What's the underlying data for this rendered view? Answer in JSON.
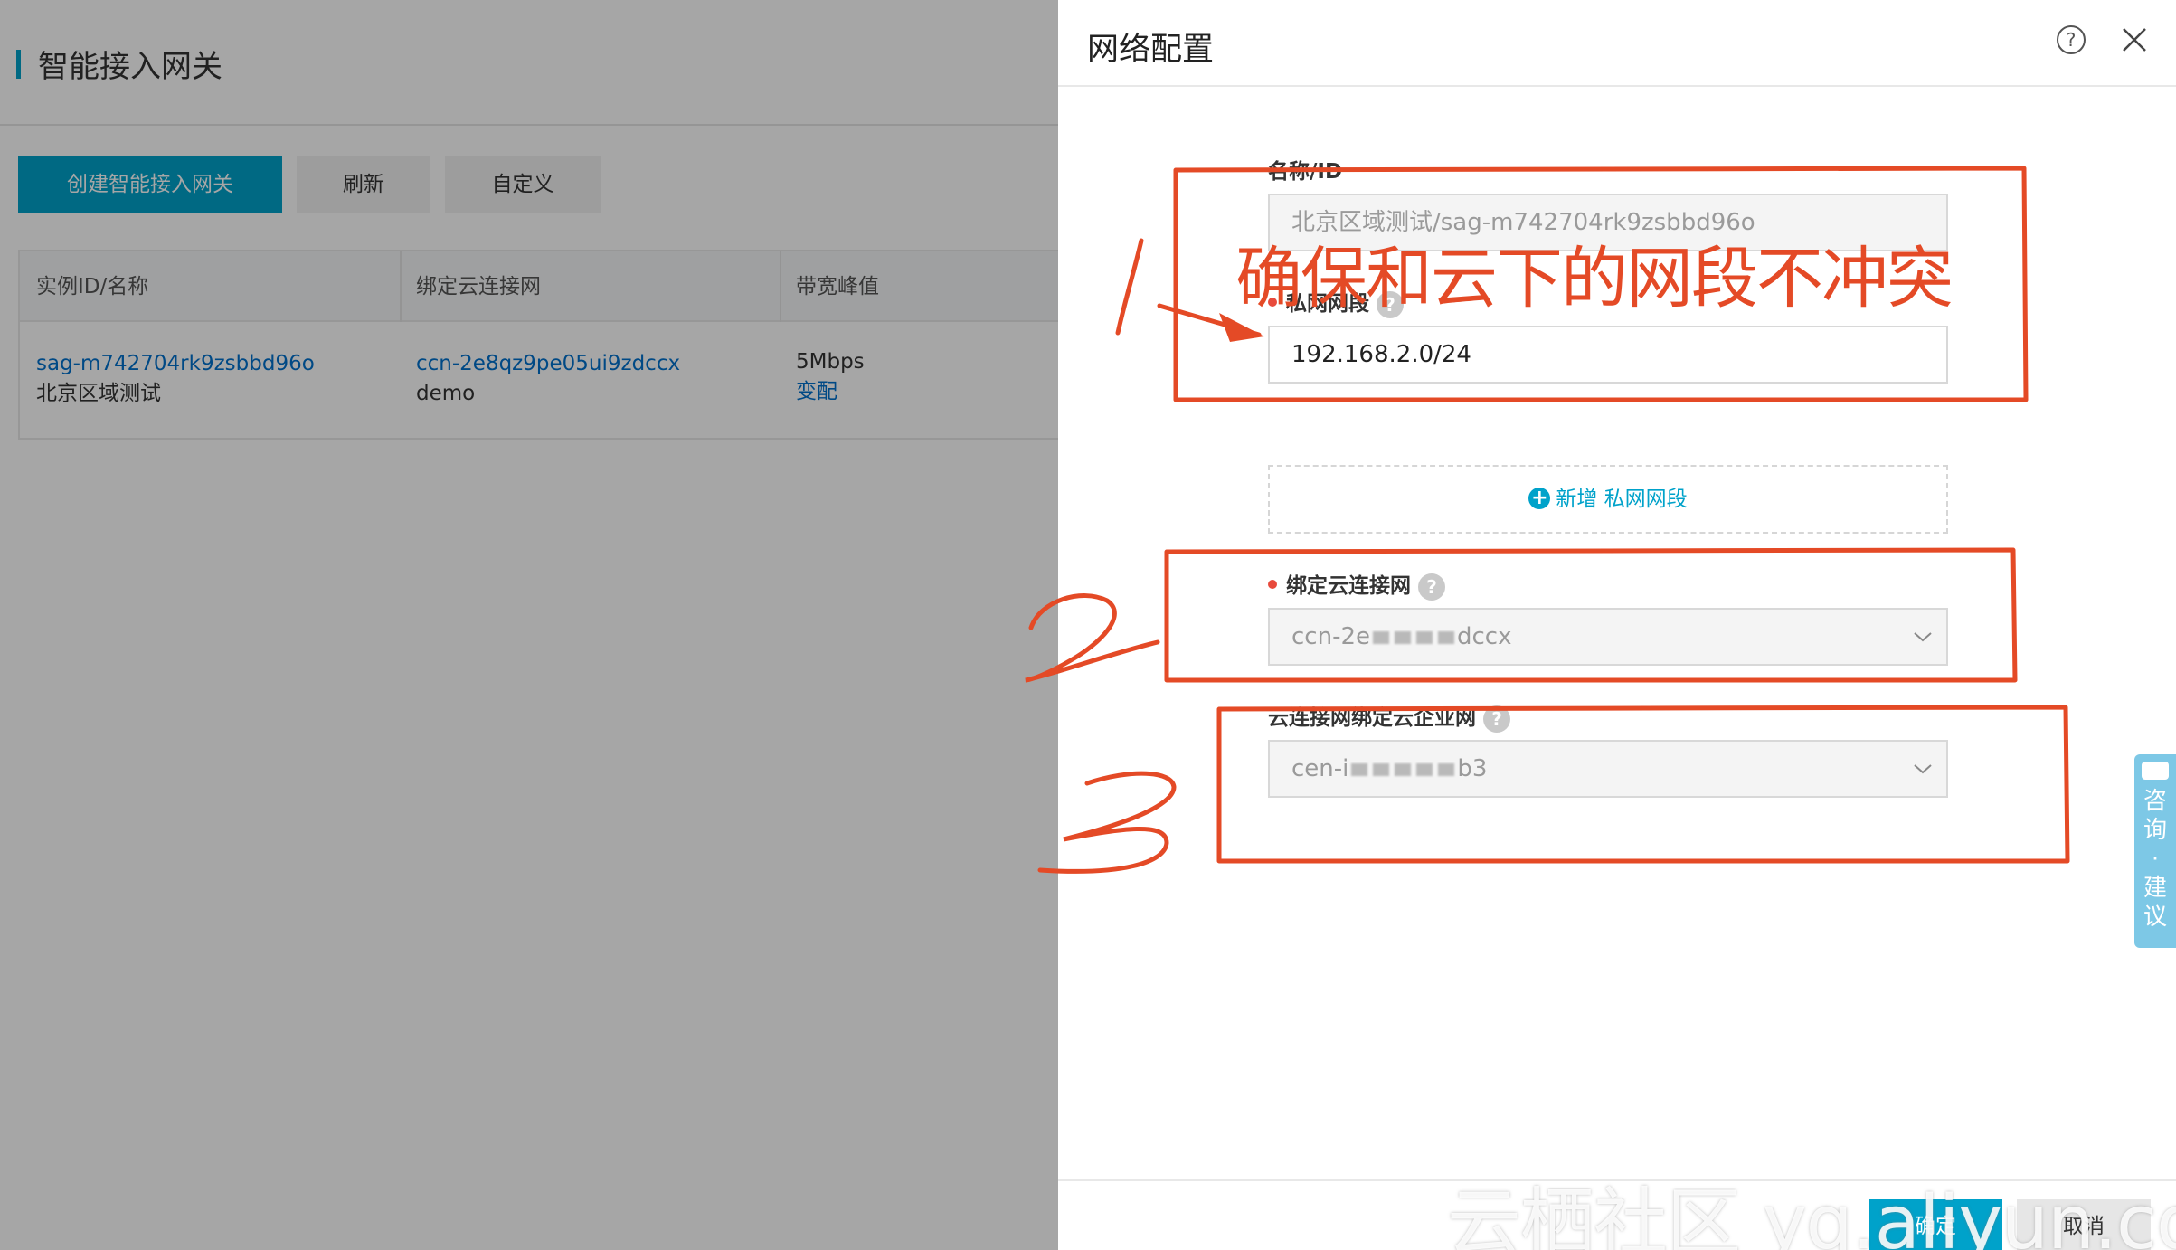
{
  "background_page": {
    "title": "智能接入网关",
    "toolbar": {
      "create_label": "创建智能接入网关",
      "refresh_label": "刷新",
      "custom_label": "自定义"
    },
    "table": {
      "columns": [
        "实例ID/名称",
        "绑定云连接网",
        "带宽峰值"
      ],
      "rows": [
        {
          "instance_id": "sag-m742704rk9zsbbd96o",
          "instance_name": "北京区域测试",
          "ccn_id": "ccn-2e8qz9pe05ui9zdccx",
          "ccn_name": "demo",
          "bandwidth": "5Mbps",
          "bandwidth_action": "变配"
        }
      ]
    }
  },
  "dialog": {
    "title": "网络配置",
    "help_symbol": "?",
    "fields": {
      "name": {
        "label": "名称/ID",
        "value": "北京区域测试/sag-m742704rk9zsbbd96o"
      },
      "private_cidr": {
        "label": "私网网段",
        "value": "192.168.2.0/24"
      },
      "add_segment_label": "新增 私网网段",
      "ccn": {
        "label": "绑定云连接网",
        "value_prefix": "ccn-2e",
        "value_suffix": "dccx"
      },
      "cen": {
        "label": "云连接网绑定云企业网",
        "value_prefix": "cen-i",
        "value_suffix": "b3"
      }
    },
    "footer": {
      "ok_label": "确定",
      "cancel_label": "取消"
    }
  },
  "feedback_tab": {
    "label": "咨询·建议"
  },
  "annotations": {
    "note": "确保和云下的网段不冲突",
    "color": "#e44a26"
  },
  "watermark": "云栖社区 yq.aliyun.com",
  "colors": {
    "primary": "#00a2ca",
    "link": "#0070cc",
    "required": "#e84a3c"
  }
}
